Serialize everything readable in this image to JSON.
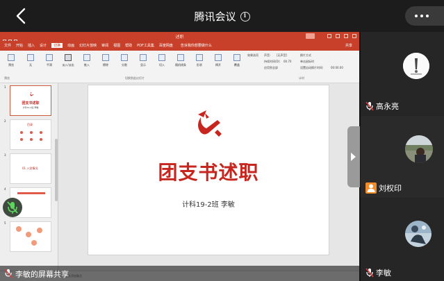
{
  "meeting": {
    "title": "腾讯会议",
    "info_icon": "i"
  },
  "ppt": {
    "doc_title": "述职",
    "menu": [
      "文件",
      "开始",
      "插入",
      "设计",
      "切换",
      "动画",
      "幻灯片放映",
      "审阅",
      "视图",
      "帮助",
      "PDF工具集",
      "百度网盘"
    ],
    "active_menu_index": 4,
    "tell_me": "告诉我你想要做什么",
    "share": "共享",
    "ribbon": {
      "preview": "预览",
      "effects": [
        "无",
        "平滑",
        "淡入/淡出",
        "推入",
        "擦除",
        "分割",
        "显示",
        "切入",
        "随机线条",
        "形状",
        "揭开",
        "覆盖"
      ],
      "effect_options": "效果选项",
      "sound_label": "声音:",
      "sound_value": "[无声音]",
      "duration_label": "持续时间(D):",
      "duration_value": "00.70",
      "apply_all": "应用到全部",
      "advance_label": "换片方式",
      "on_click": "单击鼠标时",
      "after_label": "设置自动换片时间:",
      "after_value": "00:00.00",
      "group_preview": "预览",
      "group_transitions": "切换到此幻灯片",
      "group_timing": "计时"
    },
    "slide_numbers": [
      "1",
      "2",
      "3",
      "4",
      "5"
    ],
    "thumbs": {
      "t1_title": "团支书述职",
      "t1_sub": "计科19-2班 李敏",
      "t2_label": "目录",
      "t3_label": "01 入党情况"
    },
    "slide": {
      "title": "团支书述职",
      "subtitle": "计科19-2班 李敏"
    },
    "status_hint": "单击此处添加备注"
  },
  "share_label": "李敏的屏幕共享",
  "participants": [
    {
      "name": "高永亮",
      "muted": true,
      "host": false
    },
    {
      "name": "刘权印",
      "muted": false,
      "host": true
    },
    {
      "name": "李敏",
      "muted": true,
      "host": false
    }
  ],
  "colors": {
    "ppt_red": "#c8402a",
    "slide_red": "#c7261f",
    "panel_bg": "#232323",
    "host_orange": "#f28c28",
    "muted_red": "#e03c3c"
  }
}
